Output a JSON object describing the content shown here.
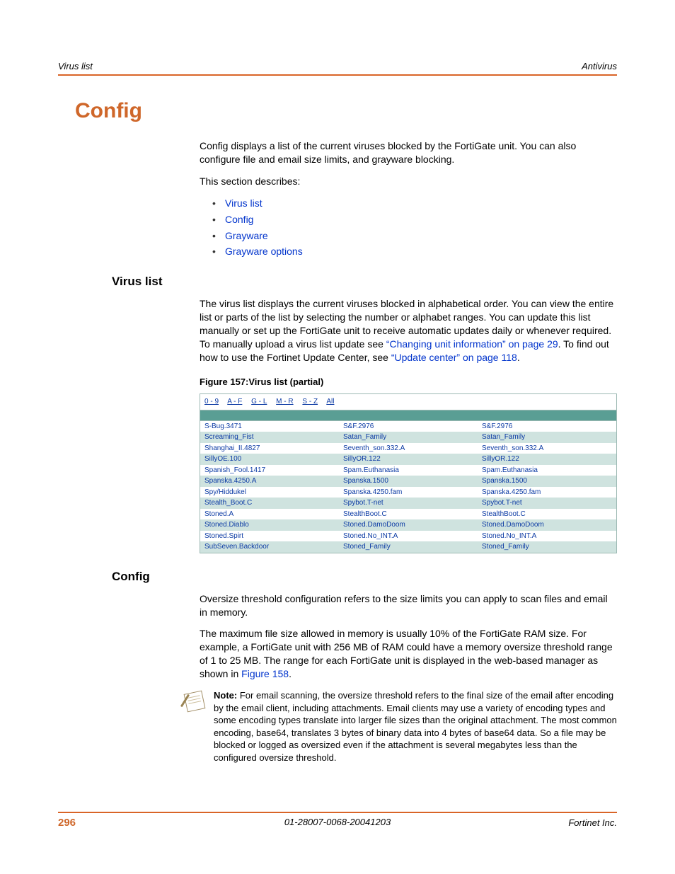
{
  "head": {
    "left": "Virus list",
    "right": "Antivirus"
  },
  "h1": "Config",
  "intro1": "Config displays a list of the current viruses blocked by the FortiGate unit. You can also configure file and email size limits, and grayware blocking.",
  "intro2": "This section describes:",
  "toc": [
    "Virus list",
    "Config",
    "Grayware",
    "Grayware options"
  ],
  "sec1": {
    "title": "Virus list",
    "p_a": "The virus list displays the current viruses blocked in alphabetical order. You can view the entire list or parts of the list by selecting the number or alphabet ranges. You can update this list manually or set up the FortiGate unit to receive automatic updates daily or whenever required. To manually upload a virus list update see ",
    "link1": "“Changing unit information” on page 29",
    "p_b": ". To find out how to use the Fortinet Update Center, see ",
    "link2": "“Update center” on page 118",
    "p_c": ".",
    "figcap": "Figure 157:Virus list (partial)",
    "ranges": [
      "0 - 9",
      "A - F",
      "G - L",
      "M - R",
      "S - Z",
      "All"
    ],
    "rows": [
      [
        "S-Bug.3471",
        "S&F.2976",
        "S&F.2976"
      ],
      [
        "Screaming_Fist",
        "Satan_Family",
        "Satan_Family"
      ],
      [
        "Shanghai_II.4827",
        "Seventh_son.332.A",
        "Seventh_son.332.A"
      ],
      [
        "SillyOE.100",
        "SillyOR.122",
        "SillyOR.122"
      ],
      [
        "Spanish_Fool.1417",
        "Spam.Euthanasia",
        "Spam.Euthanasia"
      ],
      [
        "Spanska.4250.A",
        "Spanska.1500",
        "Spanska.1500"
      ],
      [
        "Spy/Hiddukel",
        "Spanska.4250.fam",
        "Spanska.4250.fam"
      ],
      [
        "Stealth_Boot.C",
        "Spybot.T-net",
        "Spybot.T-net"
      ],
      [
        "Stoned.A",
        "StealthBoot.C",
        "StealthBoot.C"
      ],
      [
        "Stoned.Diablo",
        "Stoned.DamoDoom",
        "Stoned.DamoDoom"
      ],
      [
        "Stoned.Spirt",
        "Stoned.No_INT.A",
        "Stoned.No_INT.A"
      ],
      [
        "SubSeven.Backdoor",
        "Stoned_Family",
        "Stoned_Family"
      ]
    ]
  },
  "sec2": {
    "title": "Config",
    "p1": "Oversize threshold configuration refers to the size limits you can apply to scan files and email in memory.",
    "p2a": "The maximum file size allowed in memory is usually 10% of the FortiGate RAM size. For example, a FortiGate unit with 256 MB of RAM could have a memory oversize threshold range of 1 to 25 MB. The range for each FortiGate unit is displayed in the web-based manager as shown in ",
    "p2link": "Figure 158",
    "p2b": ".",
    "note_label": "Note:",
    "note": " For email scanning, the oversize threshold refers to the final size of the email after encoding by the email client, including attachments. Email clients may use a variety of encoding types and some encoding types translate into larger file sizes than the original attachment. The most common encoding, base64, translates 3 bytes of binary data into 4 bytes of base64 data. So a file may be blocked or logged as oversized even if the attachment is several megabytes less than the configured oversize threshold."
  },
  "footer": {
    "page": "296",
    "center": "01-28007-0068-20041203",
    "right": "Fortinet Inc."
  }
}
